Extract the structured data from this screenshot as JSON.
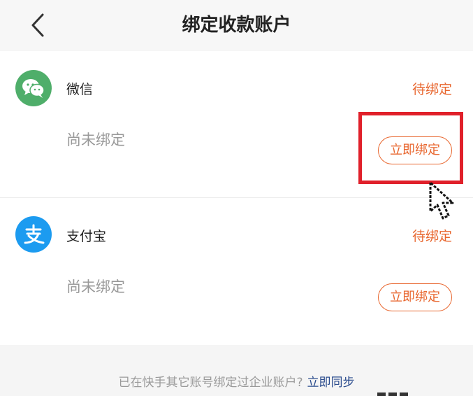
{
  "header": {
    "title": "绑定收款账户"
  },
  "accounts": [
    {
      "name": "微信",
      "status": "待绑定",
      "bind_state": "尚未绑定",
      "button_label": "立即绑定",
      "icon": "wechat-icon",
      "color": "#4fae6a"
    },
    {
      "name": "支付宝",
      "status": "待绑定",
      "bind_state": "尚未绑定",
      "button_label": "立即绑定",
      "icon": "alipay-icon",
      "color": "#1c9bf0"
    }
  ],
  "footer": {
    "note": "已在快手其它账号绑定过企业账户?",
    "sync_link": "立即同步"
  },
  "colors": {
    "accent": "#e8662e",
    "link": "#2c4d8e",
    "highlight": "#e0202a"
  }
}
